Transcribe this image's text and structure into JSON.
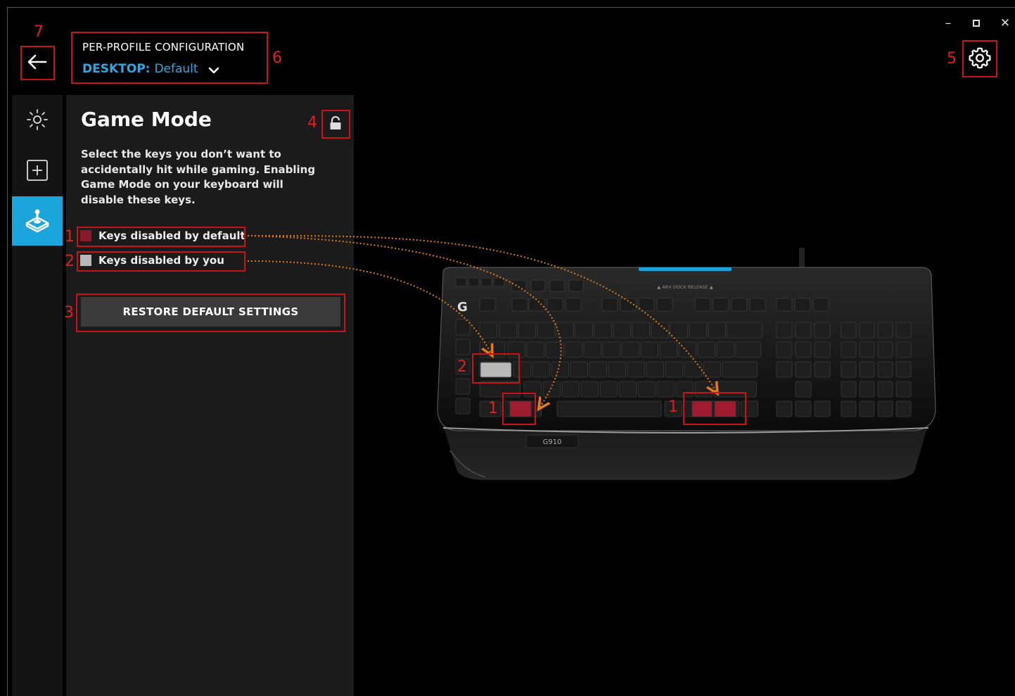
{
  "window": {
    "minimize_glyph": "–",
    "close_glyph": "✕"
  },
  "header": {
    "back_icon": "arrow-left-icon",
    "profile_title": "PER-PROFILE CONFIGURATION",
    "profile_scope": "DESKTOP:",
    "profile_name": "Default",
    "settings_icon": "gear-icon"
  },
  "sidebar": {
    "items": [
      {
        "name": "lighting",
        "icon": "sun-brightness-icon",
        "active": false
      },
      {
        "name": "assignments",
        "icon": "plus-square-icon",
        "active": false
      },
      {
        "name": "game-mode",
        "icon": "joystick-icon",
        "active": true
      }
    ]
  },
  "panel": {
    "title": "Game Mode",
    "lock_icon": "lock-open-icon",
    "description": "Select the keys you don’t want to accidentally hit while gaming. Enabling Game Mode on your keyboard will disable these keys.",
    "legend": [
      {
        "label": "Keys disabled by default",
        "color": "#8a1a28"
      },
      {
        "label": "Keys disabled by you",
        "color": "#b8b8b8"
      }
    ],
    "restore_label": "RESTORE DEFAULT SETTINGS"
  },
  "callout_numbers": {
    "n1": "1",
    "n2": "2",
    "n3": "3",
    "n4": "4",
    "n5": "5",
    "n6": "6",
    "n7": "7"
  },
  "keyboard": {
    "model_label": "G910",
    "arx_label": "▲ ARX DOCK RELEASE ▲",
    "accent_color": "#1aa6dd",
    "disabled_default_color": "#a01a30",
    "disabled_user_color": "#b8b8b8"
  },
  "annotation": {
    "callout_color": "#c8121a",
    "arrow_color": "#e07a1e"
  }
}
